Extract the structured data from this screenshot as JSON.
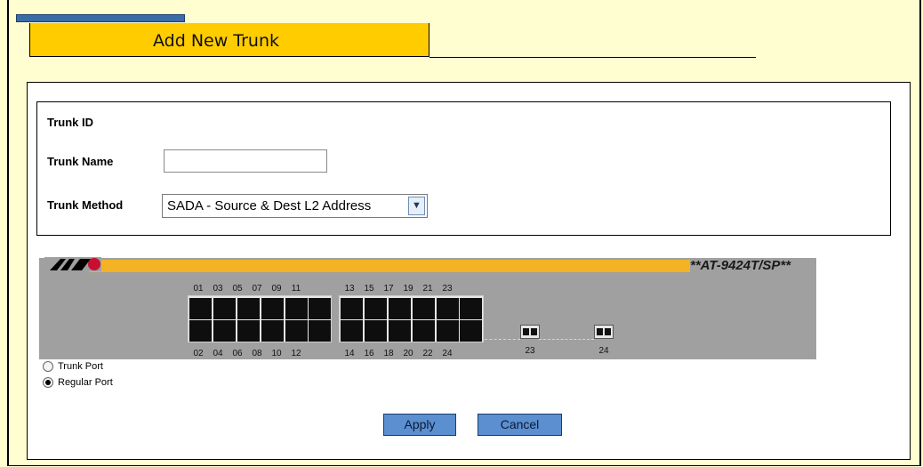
{
  "page": {
    "title": "Add New Trunk"
  },
  "form": {
    "trunk_id_label": "Trunk ID",
    "trunk_name_label": "Trunk Name",
    "trunk_name_value": "",
    "trunk_method_label": "Trunk Method",
    "trunk_method_value": "SADA - Source & Dest L2 Address"
  },
  "switch": {
    "model": "**AT-9424T/SP**",
    "top_ports": [
      "01",
      "03",
      "05",
      "07",
      "09",
      "11",
      "13",
      "15",
      "17",
      "19",
      "21",
      "23"
    ],
    "bottom_ports": [
      "02",
      "04",
      "06",
      "08",
      "10",
      "12",
      "14",
      "16",
      "18",
      "20",
      "22",
      "24"
    ],
    "sfp_ports": [
      "23",
      "24"
    ]
  },
  "legend": {
    "trunk_port": "Trunk Port",
    "regular_port": "Regular Port",
    "selected": "regular_port"
  },
  "buttons": {
    "apply": "Apply",
    "cancel": "Cancel"
  },
  "colors": {
    "title_bg": "#ffcc00",
    "switch_band": "#f3b324",
    "button_bg": "#5b8fcf",
    "page_bg": "#fefed0"
  }
}
